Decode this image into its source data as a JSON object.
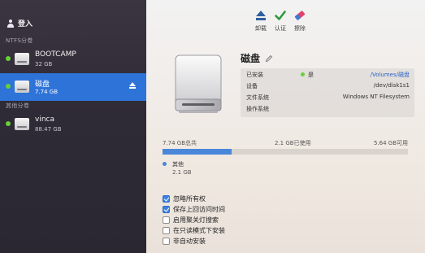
{
  "sidebar": {
    "login_label": "登入",
    "sections": [
      {
        "header": "NTFS分卷"
      },
      {
        "header": "其他分卷"
      }
    ],
    "items": [
      {
        "name": "BOOTCAMP",
        "size": "32 GB",
        "mounted": true,
        "selected": false
      },
      {
        "name": "磁盘",
        "size": "7.74 GB",
        "mounted": true,
        "selected": true
      },
      {
        "name": "vinca",
        "size": "88.47 GB",
        "mounted": true,
        "selected": false
      }
    ]
  },
  "toolbar": {
    "unmount_label": "卸载",
    "verify_label": "认证",
    "erase_label": "擦除"
  },
  "volume": {
    "title": "磁盘",
    "info": [
      {
        "key": "已安装",
        "status_value": "是",
        "value": "/Volumes/磁盘"
      },
      {
        "key": "设备",
        "value": "/dev/disk1s1"
      },
      {
        "key": "文件系统",
        "value": "Windows NT Filesystem"
      },
      {
        "key": "操作系统",
        "value": ""
      }
    ]
  },
  "capacity": {
    "total_label": "7.74 GB总共",
    "used_label": "2.1 GB已使用",
    "free_label": "5.64 GB可用",
    "used_fraction": 0.28,
    "legend_name": "其他",
    "legend_size": "2.1 GB"
  },
  "options": [
    {
      "label": "忽略所有权",
      "checked": true
    },
    {
      "label": "保存上回访问时间",
      "checked": true
    },
    {
      "label": "启用聚关灯搜索",
      "checked": false
    },
    {
      "label": "在只读模式下安装",
      "checked": false
    },
    {
      "label": "非自动安装",
      "checked": false
    }
  ],
  "colors": {
    "accent": "#2e73d8",
    "mounted": "#67d136",
    "capacity_fill": "#4a86d9",
    "link": "#2b63c6"
  }
}
